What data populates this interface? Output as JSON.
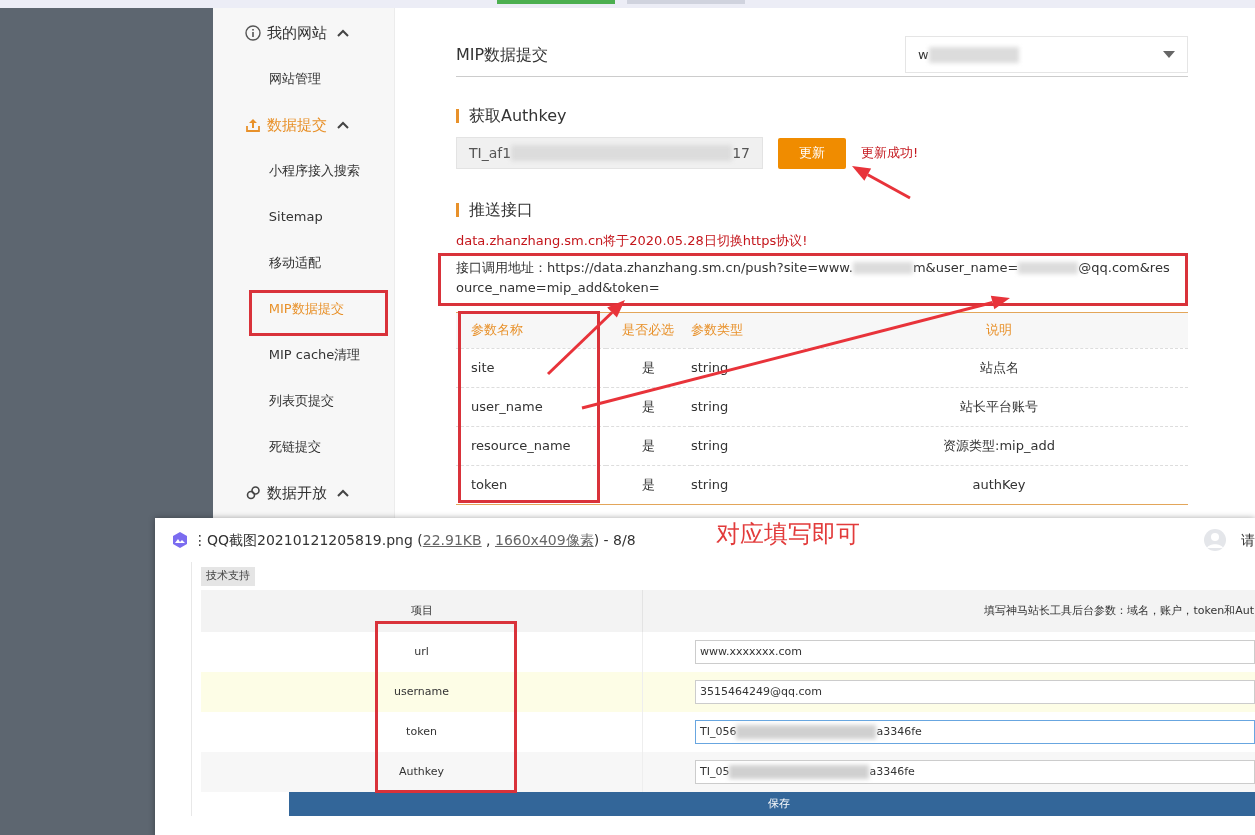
{
  "top_tabs": [
    {
      "selected": true
    },
    {
      "selected": false
    }
  ],
  "sidebar": [
    {
      "label": "我的网站",
      "kind": "info",
      "expanded": true,
      "selected": false,
      "children": [
        {
          "label": "网站管理",
          "selected": false
        }
      ]
    },
    {
      "label": "数据提交",
      "kind": "upload",
      "expanded": true,
      "selected": true,
      "children": [
        {
          "label": "小程序接入搜索",
          "selected": false
        },
        {
          "label": "Sitemap",
          "selected": false
        },
        {
          "label": "移动适配",
          "selected": false
        },
        {
          "label": "MIP数据提交",
          "selected": true
        },
        {
          "label": "MIP cache清理",
          "selected": false
        },
        {
          "label": "列表页提交",
          "selected": false
        },
        {
          "label": "死链提交",
          "selected": false
        }
      ]
    },
    {
      "label": "数据开放",
      "kind": "link",
      "expanded": true,
      "selected": false
    }
  ],
  "page_title": "MIP数据提交",
  "site_select": {
    "value": "w"
  },
  "authkey_section": {
    "title": "获取Authkey",
    "value_start": "TI_af1",
    "value_end": "17",
    "button": "更新",
    "message": "更新成功!"
  },
  "push_section": {
    "title": "推送接口",
    "notice": "data.zhanzhang.sm.cn将于2020.05.28日切换https协议!",
    "address_parts": [
      {
        "kind": "text",
        "text": "接口调用地址：https://data.zhanzhang.sm.cn/push?site=www."
      },
      {
        "kind": "blur"
      },
      {
        "kind": "text",
        "text": "m&user_name="
      },
      {
        "kind": "blur"
      },
      {
        "kind": "text",
        "text": "@qq.com&resource_name=mip_add&token="
      }
    ]
  },
  "param_table": {
    "columns": [
      "参数名称",
      "是否必选",
      "参数类型",
      "说明"
    ],
    "rows": [
      [
        "site",
        "是",
        "string",
        "站点名"
      ],
      [
        "user_name",
        "是",
        "string",
        "站长平台账号"
      ],
      [
        "resource_name",
        "是",
        "string",
        "资源类型:mip_add"
      ],
      [
        "token",
        "是",
        "string",
        "authKey"
      ]
    ]
  },
  "annotation": "对应填写即可",
  "viewer": {
    "title_start": "⋮QQ截图20210121205819.png (",
    "size_link": "22.91KB",
    "separator": " , ",
    "dims_link": "1660x409像素",
    "title_end": ") - 8/8",
    "login": "请",
    "support_button": "技术支持",
    "table": {
      "columns": [
        "项目",
        "填写神马站长工具后台参数：域名，账户，token和Aut"
      ],
      "rows": [
        {
          "label": "url",
          "value_start": "www.xxxxxxx.com",
          "blurred": false,
          "highlighted": false,
          "focused": false
        },
        {
          "label": "username",
          "value_start": "3515464249@qq.com",
          "blurred": false,
          "highlighted": true,
          "focused": false
        },
        {
          "label": "token",
          "value_start": "TI_056",
          "value_end": "a3346fe",
          "blurred": true,
          "highlighted": false,
          "focused": true
        },
        {
          "label": "Authkey",
          "value_start": "TI_05",
          "value_end": "a3346fe",
          "blurred": true,
          "highlighted": false,
          "focused": false
        }
      ]
    },
    "save_button": "保存"
  }
}
